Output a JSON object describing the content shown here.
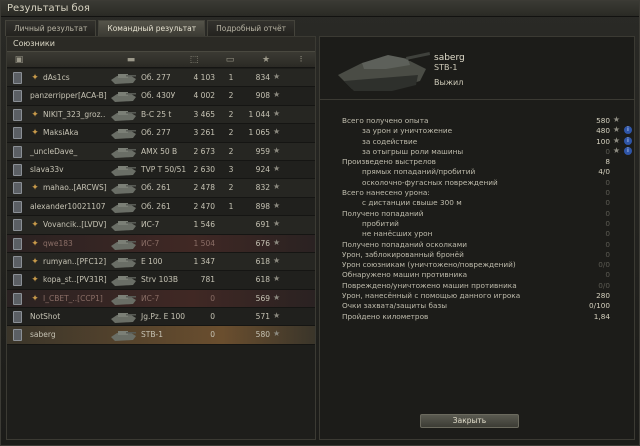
{
  "window": {
    "title": "Результаты боя"
  },
  "tabs": [
    {
      "label": "Личный результат",
      "active": false
    },
    {
      "label": "Командный результат",
      "active": true
    },
    {
      "label": "Подробный отчёт",
      "active": false
    }
  ],
  "team": {
    "header": "Союзники",
    "rows": [
      {
        "player": "dAs1cs",
        "clan_emblem": true,
        "vehicle": "Об. 277",
        "damage": "4 103",
        "kills": "1",
        "xp": "834",
        "state": "alive"
      },
      {
        "player": "panzerripper[ACA-B]",
        "clan_emblem": false,
        "vehicle": "Об. 430У",
        "damage": "4 002",
        "kills": "2",
        "xp": "908",
        "state": "alive"
      },
      {
        "player": "NIKIT_323_groz..",
        "clan_emblem": true,
        "vehicle": "В-С 25 t",
        "damage": "3 465",
        "kills": "2",
        "xp": "1 044",
        "state": "alive"
      },
      {
        "player": "MaksiAka",
        "clan_emblem": true,
        "vehicle": "Об. 277",
        "damage": "3 261",
        "kills": "2",
        "xp": "1 065",
        "state": "alive"
      },
      {
        "player": "_uncleDave_",
        "clan_emblem": false,
        "vehicle": "AMX 50 B",
        "damage": "2 673",
        "kills": "2",
        "xp": "959",
        "state": "alive"
      },
      {
        "player": "slava33v",
        "clan_emblem": false,
        "vehicle": "TVP T 50/51",
        "damage": "2 630",
        "kills": "3",
        "xp": "924",
        "state": "alive"
      },
      {
        "player": "mahao..[ARCWS]",
        "clan_emblem": true,
        "vehicle": "Об. 261",
        "damage": "2 478",
        "kills": "2",
        "xp": "832",
        "state": "alive"
      },
      {
        "player": "alexander10021107",
        "clan_emblem": false,
        "vehicle": "Об. 261",
        "damage": "2 470",
        "kills": "1",
        "xp": "898",
        "state": "alive"
      },
      {
        "player": "Vovancik..[LVDV]",
        "clan_emblem": true,
        "vehicle": "ИС-7",
        "damage": "1 546",
        "kills": "",
        "xp": "691",
        "state": "alive"
      },
      {
        "player": "qwe183",
        "clan_emblem": true,
        "vehicle": "ИС-7",
        "damage": "1 504",
        "kills": "",
        "xp": "676",
        "state": "dead"
      },
      {
        "player": "rumyan..[PFC12]",
        "clan_emblem": true,
        "vehicle": "E 100",
        "damage": "1 347",
        "kills": "",
        "xp": "618",
        "state": "alive"
      },
      {
        "player": "kopa_st..[PV31R]",
        "clan_emblem": true,
        "vehicle": "Strv 103B",
        "damage": "781",
        "kills": "",
        "xp": "618",
        "state": "alive"
      },
      {
        "player": "I_CBET_..[CCP1]",
        "clan_emblem": true,
        "vehicle": "ИС-7",
        "damage": "0",
        "kills": "",
        "xp": "569",
        "state": "dead"
      },
      {
        "player": "NotShot",
        "clan_emblem": false,
        "vehicle": "Jg.Pz. E 100",
        "damage": "0",
        "kills": "",
        "xp": "571",
        "state": "alive"
      },
      {
        "player": "saberg",
        "clan_emblem": false,
        "vehicle": "STB-1",
        "damage": "0",
        "kills": "",
        "xp": "580",
        "state": "self"
      }
    ]
  },
  "detail": {
    "player": "saberg",
    "vehicle": "STB-1",
    "status": "Выжил",
    "stats": [
      {
        "label": "Всего получено опыта",
        "value": "580",
        "indent": false,
        "star": true,
        "info": false,
        "dim": false
      },
      {
        "label": "за урон и уничтожение",
        "value": "480",
        "indent": true,
        "star": true,
        "info": true,
        "dim": false
      },
      {
        "label": "за содействие",
        "value": "100",
        "indent": true,
        "star": true,
        "info": true,
        "dim": false
      },
      {
        "label": "за отыгрыш роли машины",
        "value": "0",
        "indent": true,
        "star": true,
        "info": true,
        "dim": true
      },
      {
        "label": "Произведено выстрелов",
        "value": "8",
        "indent": false,
        "star": false,
        "info": false,
        "dim": false
      },
      {
        "label": "прямых попаданий/пробитий",
        "value": "4/0",
        "indent": true,
        "star": false,
        "info": false,
        "dim": false
      },
      {
        "label": "осколочно-фугасных повреждений",
        "value": "0",
        "indent": true,
        "star": false,
        "info": false,
        "dim": true
      },
      {
        "label": "Всего нанесено урона:",
        "value": "0",
        "indent": false,
        "star": false,
        "info": false,
        "dim": true
      },
      {
        "label": "с дистанции свыше 300 м",
        "value": "0",
        "indent": true,
        "star": false,
        "info": false,
        "dim": true
      },
      {
        "label": "Получено попаданий",
        "value": "0",
        "indent": false,
        "star": false,
        "info": false,
        "dim": true
      },
      {
        "label": "пробитий",
        "value": "0",
        "indent": true,
        "star": false,
        "info": false,
        "dim": true
      },
      {
        "label": "не нанёсших урон",
        "value": "0",
        "indent": true,
        "star": false,
        "info": false,
        "dim": true
      },
      {
        "label": "Получено попаданий осколками",
        "value": "0",
        "indent": false,
        "star": false,
        "info": false,
        "dim": true
      },
      {
        "label": "Урон, заблокированный бронёй",
        "value": "0",
        "indent": false,
        "star": false,
        "info": false,
        "dim": true
      },
      {
        "label": "Урон союзникам (уничтожено/повреждений)",
        "value": "0/0",
        "indent": false,
        "star": false,
        "info": false,
        "dim": true
      },
      {
        "label": "Обнаружено машин противника",
        "value": "0",
        "indent": false,
        "star": false,
        "info": false,
        "dim": true
      },
      {
        "label": "Повреждено/уничтожено машин противника",
        "value": "0/0",
        "indent": false,
        "star": false,
        "info": false,
        "dim": true
      },
      {
        "label": "Урон, нанесённый с помощью данного игрока",
        "value": "280",
        "indent": false,
        "star": false,
        "info": false,
        "dim": false
      },
      {
        "label": "Очки захвата/защиты базы",
        "value": "0/100",
        "indent": false,
        "star": false,
        "info": false,
        "dim": false
      },
      {
        "label": "Пройдено километров",
        "value": "1,84",
        "indent": false,
        "star": false,
        "info": false,
        "dim": false
      }
    ]
  },
  "buttons": {
    "close": "Закрыть"
  },
  "icons": {
    "column_vehicle": "tank-icon",
    "column_damage": "damage-icon",
    "column_kills": "kills-icon",
    "column_xp": "star-icon",
    "column_status": "status-icon"
  }
}
